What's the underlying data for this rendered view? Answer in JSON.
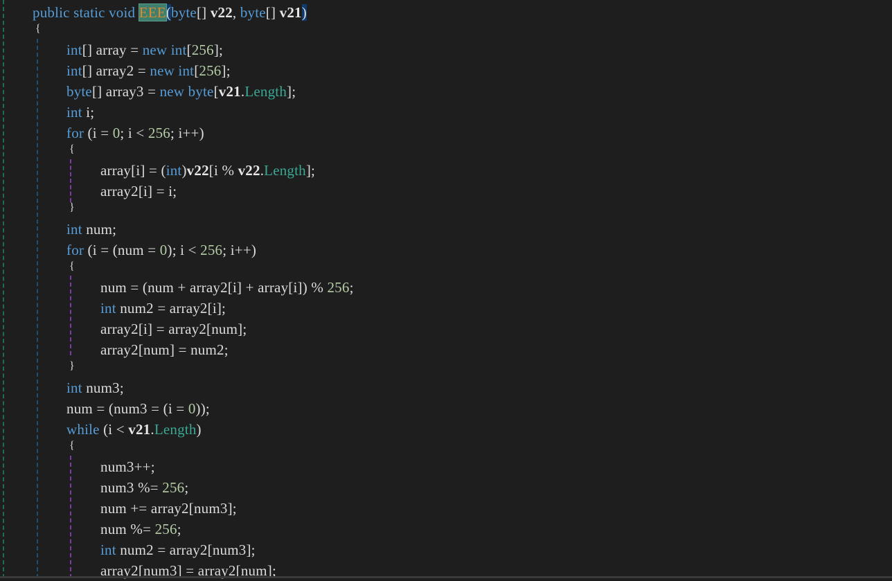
{
  "editor": {
    "language": "C#",
    "colors": {
      "background": "#1e1e1e",
      "keyword": "#569cd6",
      "number": "#b5cea8",
      "property": "#3aa894",
      "identifier": "#dcdcdc",
      "method_highlight_text": "#e08a2e",
      "method_highlight_bg": "#3f7f6e",
      "brace_match_bg": "#0e3c6e"
    },
    "lines": [
      [
        {
          "t": "kw",
          "v": "public static void "
        },
        {
          "t": "fn",
          "v": "EEE"
        },
        {
          "t": "brace-hl",
          "v": "("
        },
        {
          "t": "kw",
          "v": "byte"
        },
        {
          "t": "plain",
          "v": "[] "
        },
        {
          "t": "param",
          "v": "v22"
        },
        {
          "t": "plain",
          "v": ", "
        },
        {
          "t": "kw",
          "v": "byte"
        },
        {
          "t": "plain",
          "v": "[] "
        },
        {
          "t": "param",
          "v": "v21"
        },
        {
          "t": "brace-hl",
          "v": ")"
        }
      ],
      [
        {
          "t": "plain",
          "v": "{"
        }
      ],
      [
        {
          "t": "kw",
          "v": "int"
        },
        {
          "t": "plain",
          "v": "[] array = "
        },
        {
          "t": "kw",
          "v": "new int"
        },
        {
          "t": "plain",
          "v": "["
        },
        {
          "t": "num",
          "v": "256"
        },
        {
          "t": "plain",
          "v": "];"
        }
      ],
      [
        {
          "t": "kw",
          "v": "int"
        },
        {
          "t": "plain",
          "v": "[] array2 = "
        },
        {
          "t": "kw",
          "v": "new int"
        },
        {
          "t": "plain",
          "v": "["
        },
        {
          "t": "num",
          "v": "256"
        },
        {
          "t": "plain",
          "v": "];"
        }
      ],
      [
        {
          "t": "kw",
          "v": "byte"
        },
        {
          "t": "plain",
          "v": "[] array3 = "
        },
        {
          "t": "kw",
          "v": "new byte"
        },
        {
          "t": "plain",
          "v": "["
        },
        {
          "t": "param",
          "v": "v21"
        },
        {
          "t": "plain",
          "v": "."
        },
        {
          "t": "prop",
          "v": "Length"
        },
        {
          "t": "plain",
          "v": "];"
        }
      ],
      [
        {
          "t": "kw",
          "v": "int"
        },
        {
          "t": "plain",
          "v": " i;"
        }
      ],
      [
        {
          "t": "kw",
          "v": "for"
        },
        {
          "t": "plain",
          "v": " (i = "
        },
        {
          "t": "num",
          "v": "0"
        },
        {
          "t": "plain",
          "v": "; i < "
        },
        {
          "t": "num",
          "v": "256"
        },
        {
          "t": "plain",
          "v": "; i++)"
        }
      ],
      [
        {
          "t": "plain",
          "v": "{"
        }
      ],
      [
        {
          "t": "plain",
          "v": "array[i] = ("
        },
        {
          "t": "kw",
          "v": "int"
        },
        {
          "t": "plain",
          "v": ")"
        },
        {
          "t": "param",
          "v": "v22"
        },
        {
          "t": "plain",
          "v": "[i % "
        },
        {
          "t": "param",
          "v": "v22"
        },
        {
          "t": "plain",
          "v": "."
        },
        {
          "t": "prop",
          "v": "Length"
        },
        {
          "t": "plain",
          "v": "];"
        }
      ],
      [
        {
          "t": "plain",
          "v": "array2[i] = i;"
        }
      ],
      [
        {
          "t": "plain",
          "v": "}"
        }
      ],
      [
        {
          "t": "kw",
          "v": "int"
        },
        {
          "t": "plain",
          "v": " num;"
        }
      ],
      [
        {
          "t": "kw",
          "v": "for"
        },
        {
          "t": "plain",
          "v": " (i = (num = "
        },
        {
          "t": "num",
          "v": "0"
        },
        {
          "t": "plain",
          "v": "); i < "
        },
        {
          "t": "num",
          "v": "256"
        },
        {
          "t": "plain",
          "v": "; i++)"
        }
      ],
      [
        {
          "t": "plain",
          "v": "{"
        }
      ],
      [
        {
          "t": "plain",
          "v": "num = (num + array2[i] + array[i]) % "
        },
        {
          "t": "num",
          "v": "256"
        },
        {
          "t": "plain",
          "v": ";"
        }
      ],
      [
        {
          "t": "kw",
          "v": "int"
        },
        {
          "t": "plain",
          "v": " num2 = array2[i];"
        }
      ],
      [
        {
          "t": "plain",
          "v": "array2[i] = array2[num];"
        }
      ],
      [
        {
          "t": "plain",
          "v": "array2[num] = num2;"
        }
      ],
      [
        {
          "t": "plain",
          "v": "}"
        }
      ],
      [
        {
          "t": "kw",
          "v": "int"
        },
        {
          "t": "plain",
          "v": " num3;"
        }
      ],
      [
        {
          "t": "plain",
          "v": "num = (num3 = (i = "
        },
        {
          "t": "num",
          "v": "0"
        },
        {
          "t": "plain",
          "v": "));"
        }
      ],
      [
        {
          "t": "kw",
          "v": "while"
        },
        {
          "t": "plain",
          "v": " (i < "
        },
        {
          "t": "param",
          "v": "v21"
        },
        {
          "t": "plain",
          "v": "."
        },
        {
          "t": "prop",
          "v": "Length"
        },
        {
          "t": "plain",
          "v": ")"
        }
      ],
      [
        {
          "t": "plain",
          "v": "{"
        }
      ],
      [
        {
          "t": "plain",
          "v": "num3++;"
        }
      ],
      [
        {
          "t": "plain",
          "v": "num3 %= "
        },
        {
          "t": "num",
          "v": "256"
        },
        {
          "t": "plain",
          "v": ";"
        }
      ],
      [
        {
          "t": "plain",
          "v": "num += array2[num3];"
        }
      ],
      [
        {
          "t": "plain",
          "v": "num %= "
        },
        {
          "t": "num",
          "v": "256"
        },
        {
          "t": "plain",
          "v": ";"
        }
      ],
      [
        {
          "t": "kw",
          "v": "int"
        },
        {
          "t": "plain",
          "v": " num2 = array2[num3];"
        }
      ],
      [
        {
          "t": "plain",
          "v": "array2[num3] = array2[num];"
        }
      ]
    ],
    "indents": [
      0,
      0,
      1,
      1,
      1,
      1,
      1,
      1,
      2,
      2,
      1,
      1,
      1,
      1,
      2,
      2,
      2,
      2,
      1,
      1,
      1,
      1,
      1,
      2,
      2,
      2,
      2,
      2,
      2
    ]
  }
}
